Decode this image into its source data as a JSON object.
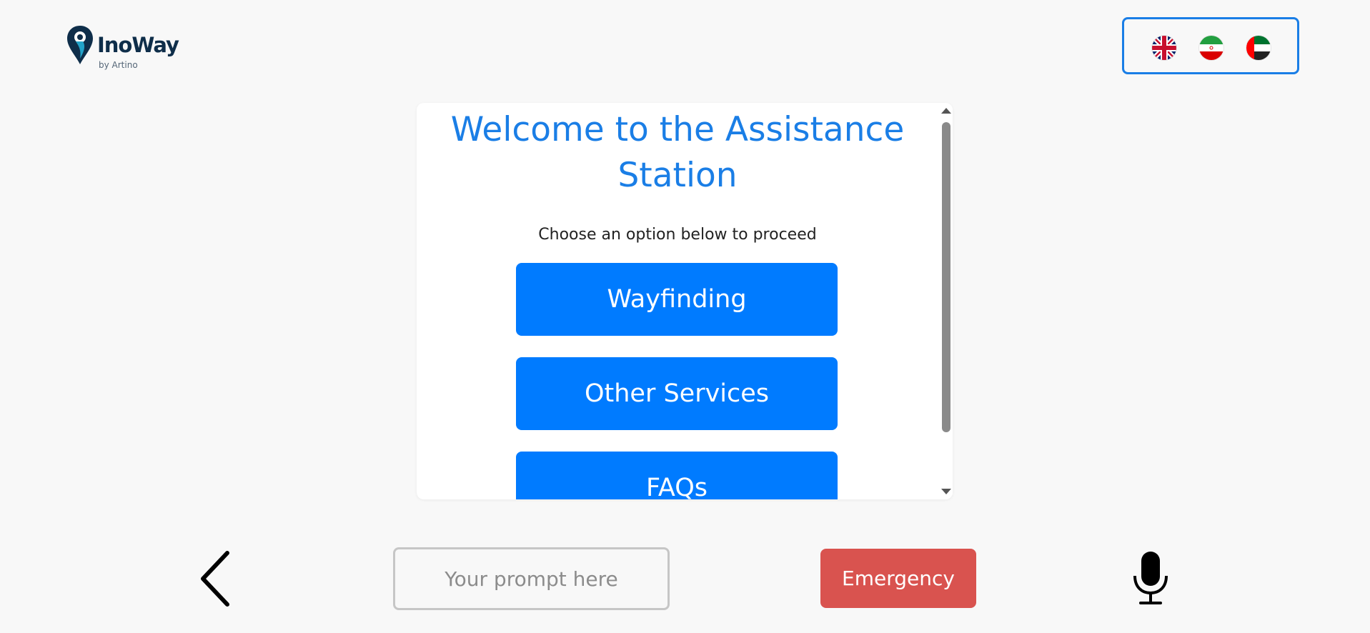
{
  "header": {
    "logo": {
      "name": "InoWay",
      "sub": "by Artino"
    },
    "languages": [
      {
        "code": "en",
        "icon": "uk-flag-icon"
      },
      {
        "code": "fa",
        "icon": "iran-flag-icon"
      },
      {
        "code": "ar",
        "icon": "uae-flag-icon"
      }
    ]
  },
  "main": {
    "title": "Welcome to the Assistance Station",
    "subtitle": "Choose an option below to proceed",
    "options": [
      {
        "label": "Wayfinding"
      },
      {
        "label": "Other Services"
      },
      {
        "label": "FAQs"
      }
    ]
  },
  "footer": {
    "back_icon": "chevron-left-icon",
    "prompt_placeholder": "Your prompt here",
    "prompt_value": "",
    "emergency_label": "Emergency",
    "mic_icon": "microphone-icon"
  },
  "colors": {
    "accent": "#007bff",
    "title": "#1a7ee6",
    "emergency": "#d9534f",
    "background": "#f8f8f8"
  }
}
